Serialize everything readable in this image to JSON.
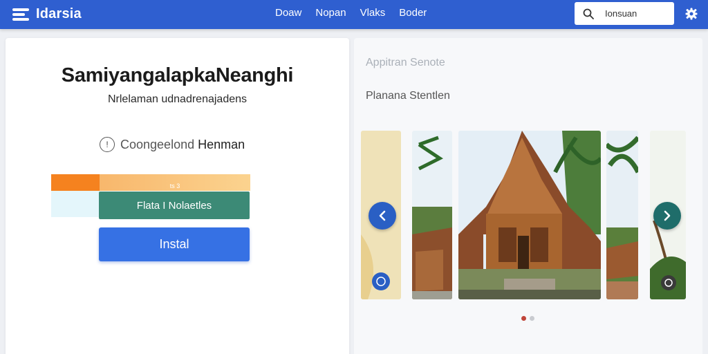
{
  "header": {
    "logo_text": "Idarsia",
    "logo_icon": "menu-lines-icon",
    "nav": [
      "Doaw",
      "Nopan",
      "Vlaks",
      "Boder"
    ],
    "search": {
      "value": "Ionsuan",
      "icon": "search-icon"
    },
    "settings_icon": "gear-icon"
  },
  "app": {
    "title": "SamiyangalapkaNeanghi",
    "subtitle": "Nrlelaman udnadrenajadens",
    "category": {
      "prefix": "Coongeelond",
      "name": "Henman",
      "icon": "info-circle-icon"
    },
    "progress_label": "ts 3",
    "secondary_button": "Flata I Nolaetles",
    "install_button": "Instal"
  },
  "gallery": {
    "label1": "Appitran Senote",
    "label2": "Planana Stentlen",
    "prev_icon": "chevron-left-icon",
    "next_icon": "chevron-right-icon",
    "dots": [
      true,
      false
    ]
  },
  "colors": {
    "header": "#2f5fd0",
    "install": "#3671e4",
    "teal": "#3c8a76",
    "orange": "#f5821f",
    "prev_arrow": "#2a5fc4",
    "next_arrow": "#1f6d6a"
  }
}
